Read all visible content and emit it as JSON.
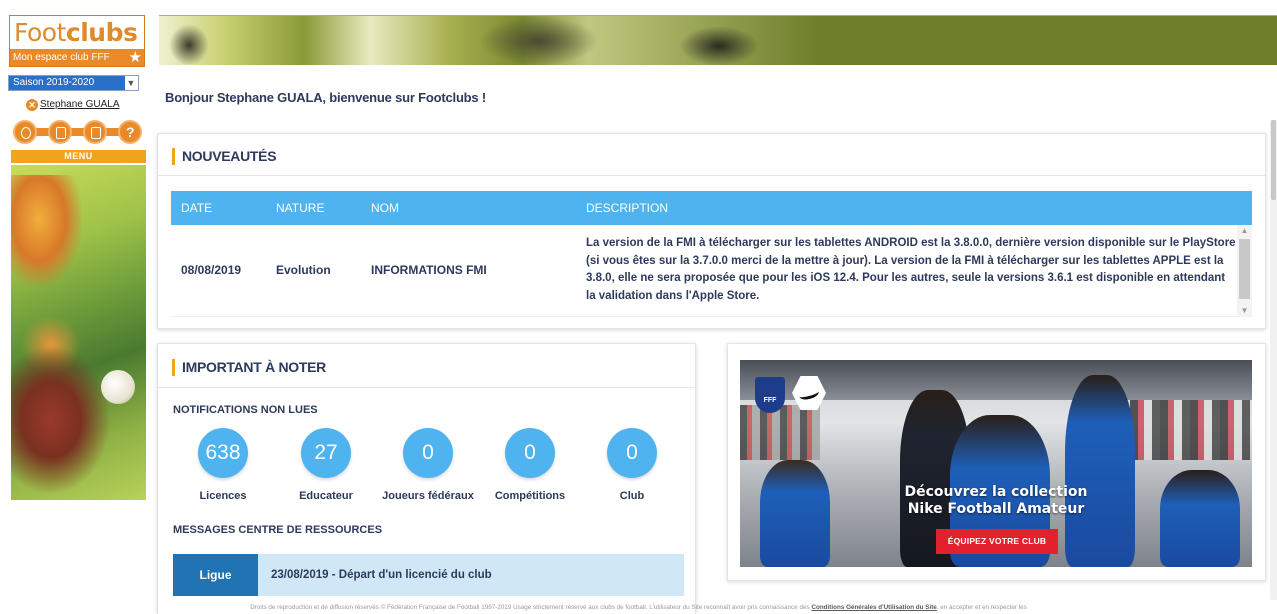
{
  "logo": {
    "word1": "Foot",
    "word2": "clubs",
    "subtitle": "Mon espace club FFF"
  },
  "season": {
    "selected": "Saison 2019-2020"
  },
  "user": {
    "name": "Stephane GUALA"
  },
  "menu": {
    "label": "MENU"
  },
  "welcome": "Bonjour Stephane GUALA, bienvenue sur Footclubs !",
  "news": {
    "title": "NOUVEAUTÉS",
    "columns": [
      "DATE",
      "NATURE",
      "NOM",
      "DESCRIPTION"
    ],
    "rows": [
      {
        "date": "08/08/2019",
        "nature": "Evolution",
        "nom": "INFORMATIONS FMI",
        "description": "La version de la FMI à télécharger sur les tablettes ANDROID est la 3.8.0.0, dernière version disponible sur le PlayStore (si vous êtes sur la 3.7.0.0 merci de la mettre à jour). La version de la FMI à télécharger sur les tablettes APPLE est la 3.8.0, elle ne sera proposée que pour les iOS 12.4. Pour les autres, seule la versions 3.6.1 est disponible en attendant la validation dans l'Apple Store."
      }
    ]
  },
  "important": {
    "title": "IMPORTANT À NOTER",
    "notifications_title": "NOTIFICATIONS NON LUES",
    "notifications": [
      {
        "count": "638",
        "label": "Licences"
      },
      {
        "count": "27",
        "label": "Educateur"
      },
      {
        "count": "0",
        "label": "Joueurs fédéraux"
      },
      {
        "count": "0",
        "label": "Compétitions"
      },
      {
        "count": "0",
        "label": "Club"
      }
    ],
    "messages_title": "MESSAGES CENTRE DE RESSOURCES",
    "messages": [
      {
        "tag": "Ligue",
        "text": "23/08/2019 - Départ d'un licencié du club"
      }
    ]
  },
  "ad": {
    "fff_label": "FFF",
    "headline_line1": "Découvrez la collection",
    "headline_line2": "Nike Football Amateur",
    "cta": "ÉQUIPEZ VOTRE CLUB"
  },
  "footer": {
    "text_before": "Droits de reproduction et de diffusion réservés © Fédération Française de Football 1997-2019 Usage strictement réservé aux clubs de football. L'utilisateur du Site reconnaît avoir pris connaissance des ",
    "link": "Conditions Générales d'Utilisation du Site",
    "text_after": ", en accepter et en respecter les"
  },
  "colors": {
    "accent_orange": "#e8892a",
    "header_blue": "#4fb3f0",
    "tag_blue": "#2174b4",
    "title_navy": "#2e3a5c"
  }
}
